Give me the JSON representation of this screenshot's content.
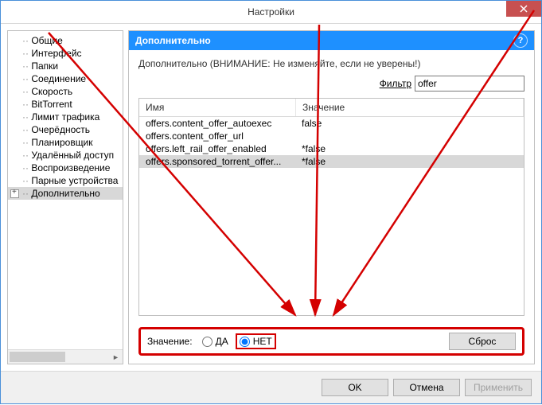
{
  "window": {
    "title": "Настройки"
  },
  "sidebar": {
    "items": [
      {
        "label": "Общие"
      },
      {
        "label": "Интерфейс"
      },
      {
        "label": "Папки"
      },
      {
        "label": "Соединение"
      },
      {
        "label": "Скорость"
      },
      {
        "label": "BitTorrent"
      },
      {
        "label": "Лимит трафика"
      },
      {
        "label": "Очерёдность"
      },
      {
        "label": "Планировщик"
      },
      {
        "label": "Удалённый доступ"
      },
      {
        "label": "Воспроизведение"
      },
      {
        "label": "Парные устройства"
      },
      {
        "label": "Дополнительно",
        "active": true,
        "expandable": true
      }
    ]
  },
  "panel": {
    "title": "Дополнительно",
    "warning": "Дополнительно (ВНИМАНИЕ: Не изменяйте, если не уверены!)",
    "filter_label": "Фильтр",
    "filter_value": "offer",
    "columns": {
      "name": "Имя",
      "value": "Значение"
    },
    "rows": [
      {
        "name": "offers.content_offer_autoexec",
        "value": "false"
      },
      {
        "name": "offers.content_offer_url",
        "value": ""
      },
      {
        "name": "offers.left_rail_offer_enabled",
        "value": "*false"
      },
      {
        "name": "offers.sponsored_torrent_offer...",
        "value": "*false",
        "selected": true
      }
    ],
    "value_label": "Значение:",
    "radio_yes": "ДА",
    "radio_no": "НЕТ",
    "reset_label": "Сброс"
  },
  "footer": {
    "ok": "OK",
    "cancel": "Отмена",
    "apply": "Применить"
  }
}
